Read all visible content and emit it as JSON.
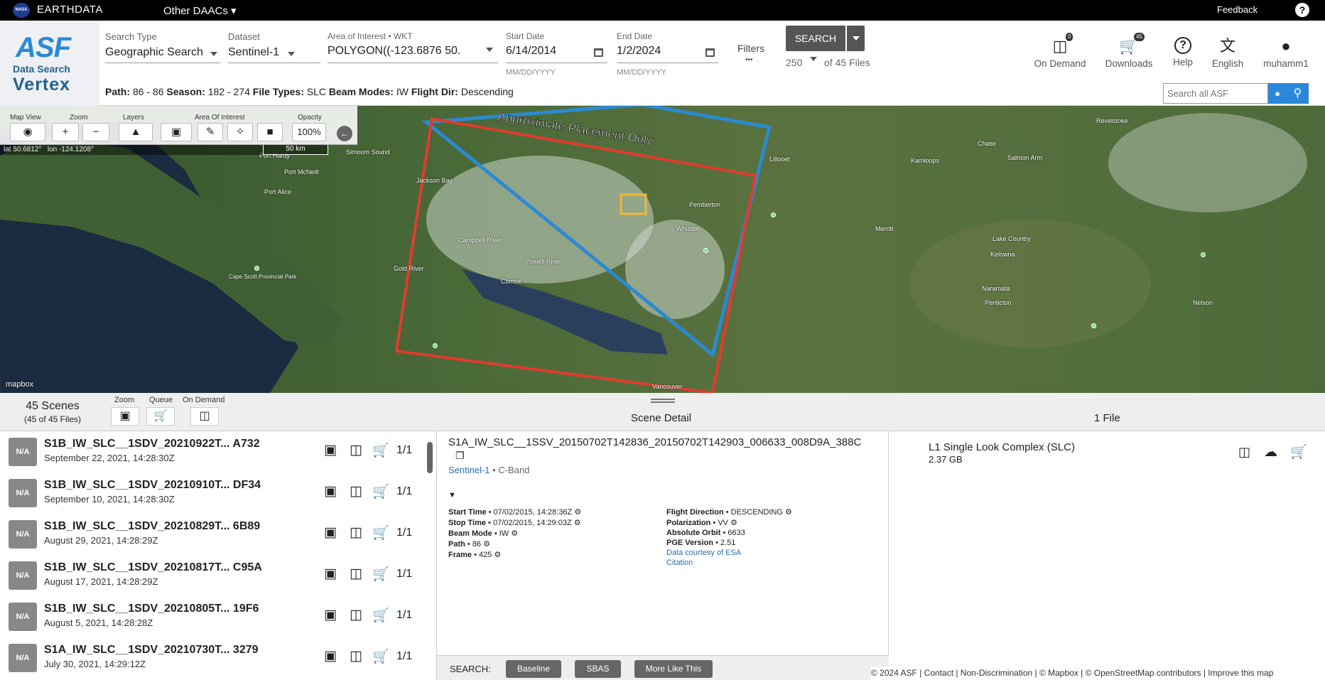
{
  "topbar": {
    "nasa": "NASA",
    "earthdata": "EARTHDATA",
    "other_daacs": "Other DAACs",
    "feedback": "Feedback",
    "help_glyph": "?"
  },
  "logo": {
    "asf": "ASF",
    "data_search": "Data Search",
    "vertex": "Vertex"
  },
  "search": {
    "type_label": "Search Type",
    "type_value": "Geographic Search",
    "dataset_label": "Dataset",
    "dataset_value": "Sentinel-1",
    "aoi_label": "Area of Interest • WKT",
    "aoi_value": "POLYGON((-123.6876 50.",
    "start_label": "Start Date",
    "start_value": "6/14/2014",
    "start_hint": "MM/DD/YYYY",
    "end_label": "End Date",
    "end_value": "1/2/2024",
    "end_hint": "MM/DD/YYYY",
    "filters_label": "Filters",
    "filters_dots": "•••",
    "search_button": "SEARCH",
    "max_results": "250",
    "of_files": "of 45 Files"
  },
  "header_icons": {
    "on_demand": "On Demand",
    "on_demand_badge": "0",
    "downloads": "Downloads",
    "downloads_badge": "45",
    "help": "Help",
    "english": "English",
    "user": "muhamm1"
  },
  "filters_summary": {
    "path_k": "Path:",
    "path_v": "86 - 86",
    "season_k": "Season:",
    "season_v": "182 - 274",
    "ft_k": "File Types:",
    "ft_v": "SLC",
    "bm_k": "Beam Modes:",
    "bm_v": "IW",
    "fd_k": "Flight Dir:",
    "fd_v": "Descending"
  },
  "searchall_placeholder": "Search all ASF",
  "map_toolbar": {
    "map_view": "Map View",
    "zoom": "Zoom",
    "layers": "Layers",
    "aoi": "Area Of Interest",
    "opacity": "Opacity",
    "opacity_value": "100%",
    "zoom_in": "+",
    "zoom_out": "−",
    "lat": "lat 50.6812°",
    "lon": "lon -124.1208°",
    "scale": "50 km"
  },
  "map": {
    "placement": "Approximate Placement Only",
    "labels": [
      "Port Hardy",
      "Port McNeill",
      "Simoom Sound",
      "Port Alice",
      "Jackson Bay",
      "Campbell River",
      "Powell River",
      "Comox",
      "Gold River",
      "Vancouver",
      "Pemberton",
      "Whistler",
      "Lillooet",
      "Kamloops",
      "Chase",
      "Salmon Arm",
      "Revelstoke",
      "Merritt",
      "Lake Country",
      "Kelowna",
      "Naramata",
      "Penticton",
      "Nelson",
      "Cape Scott Provincial Park"
    ],
    "mapbox": "mapbox"
  },
  "bottombar": {
    "scenes": "45 Scenes",
    "scenes_sub": "(45 of 45 Files)",
    "zoom": "Zoom",
    "queue": "Queue",
    "on_demand": "On Demand",
    "scene_detail": "Scene Detail",
    "files": "1 File"
  },
  "scenes": [
    {
      "name": "S1B_IW_SLC__1SDV_20210922T... A732",
      "date": "September 22, 2021, 14:28:30Z",
      "count": "1/1"
    },
    {
      "name": "S1B_IW_SLC__1SDV_20210910T... DF34",
      "date": "September 10, 2021, 14:28:30Z",
      "count": "1/1"
    },
    {
      "name": "S1B_IW_SLC__1SDV_20210829T... 6B89",
      "date": "August 29, 2021, 14:28:29Z",
      "count": "1/1"
    },
    {
      "name": "S1B_IW_SLC__1SDV_20210817T... C95A",
      "date": "August 17, 2021, 14:28:29Z",
      "count": "1/1"
    },
    {
      "name": "S1B_IW_SLC__1SDV_20210805T... 19F6",
      "date": "August 5, 2021, 14:28:28Z",
      "count": "1/1"
    },
    {
      "name": "S1A_IW_SLC__1SDV_20210730T... 3279",
      "date": "July 30, 2021, 14:29:12Z",
      "count": "1/1"
    }
  ],
  "na": "N/A",
  "detail": {
    "title": "S1A_IW_SLC__1SSV_20150702T142836_20150702T142903_006633_008D9A_388C",
    "dataset": "Sentinel-1",
    "band": "• C-Band",
    "start": "Start Time",
    "start_v": "• 07/02/2015, 14:28:36Z",
    "stop": "Stop Time",
    "stop_v": "• 07/02/2015, 14:29:03Z",
    "beam": "Beam Mode",
    "beam_v": "• IW",
    "path": "Path",
    "path_v": "• 86",
    "frame": "Frame",
    "frame_v": "• 425",
    "fdir": "Flight Direction",
    "fdir_v": "• DESCENDING",
    "pol": "Polarization",
    "pol_v": "• VV",
    "orbit": "Absolute Orbit",
    "orbit_v": "• 6633",
    "pge": "PGE Version",
    "pge_v": "• 2.51",
    "courtesy": "Data courtesy of ESA",
    "citation": "Citation"
  },
  "actions": {
    "label": "SEARCH:",
    "baseline": "Baseline",
    "sbas": "SBAS",
    "more": "More Like This"
  },
  "file": {
    "name": "L1 Single Look Complex (SLC)",
    "size": "2.37 GB"
  },
  "footer": "© 2024 ASF  |  Contact  |  Non-Discrimination  |  © Mapbox  |  © OpenStreetMap contributors  |  Improve this map"
}
